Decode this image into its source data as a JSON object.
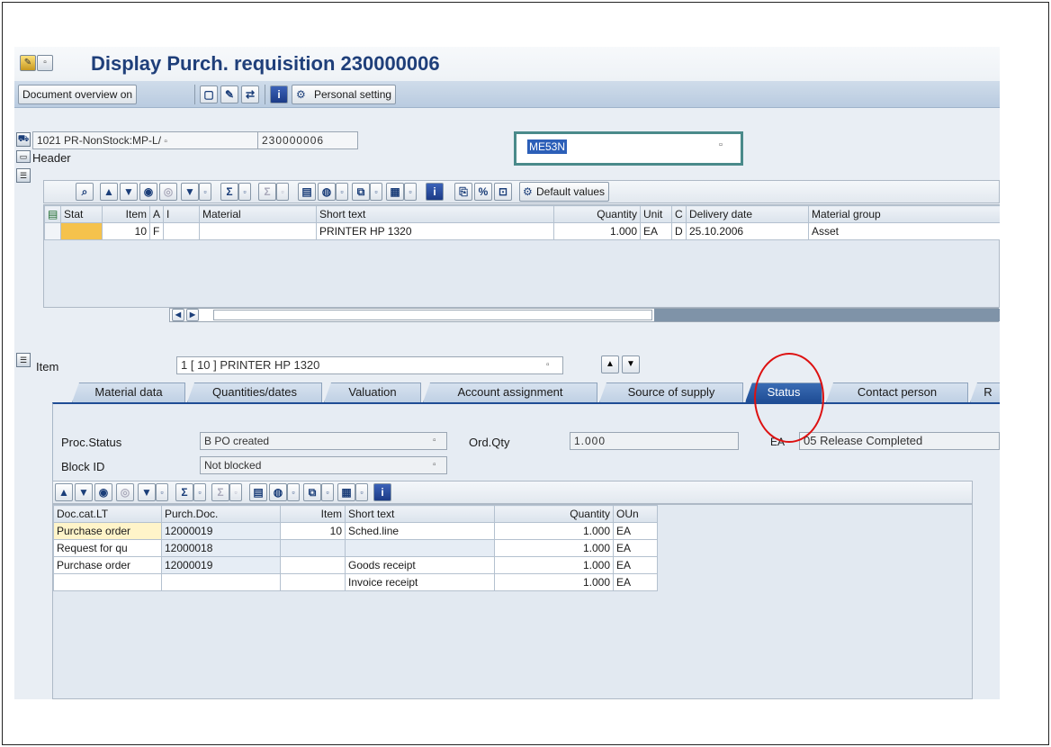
{
  "window": {
    "title": "Display Purch. requisition 230000006"
  },
  "toolbar": {
    "doc_overview_label": "Document overview on",
    "personal_setting_label": "Personal setting"
  },
  "header": {
    "doc_type": "1021 PR-NonStock:MP-L/",
    "doc_number": "230000006",
    "label": "Header"
  },
  "command_field": {
    "value": "ME53N"
  },
  "items_grid": {
    "toolbar_default_label": "Default values",
    "columns": [
      "Stat",
      "Item",
      "A",
      "I",
      "Material",
      "Short text",
      "Quantity",
      "Unit",
      "C",
      "Delivery date",
      "Material group"
    ],
    "rows": [
      {
        "stat": "",
        "item": "10",
        "a": "F",
        "i": "",
        "material": "",
        "short_text": "PRINTER HP 1320",
        "quantity": "1.000",
        "unit": "EA",
        "c": "D",
        "delivery_date": "25.10.2006",
        "material_group": "Asset"
      }
    ]
  },
  "item_section": {
    "label": "Item",
    "selected": "1 [ 10 ] PRINTER HP 1320"
  },
  "tabs": [
    {
      "label": "Material data"
    },
    {
      "label": "Quantities/dates"
    },
    {
      "label": "Valuation"
    },
    {
      "label": "Account assignment"
    },
    {
      "label": "Source of supply"
    },
    {
      "label": "Status"
    },
    {
      "label": "Contact person"
    },
    {
      "label": "R"
    }
  ],
  "status_tab": {
    "proc_status_label": "Proc.Status",
    "proc_status_value": "B PO created",
    "ord_qty_label": "Ord.Qty",
    "ord_qty_value": "1.000",
    "ord_qty_unit": "EA",
    "release_status": "05 Release Completed",
    "block_id_label": "Block ID",
    "block_id_value": "Not blocked"
  },
  "history_grid": {
    "columns": [
      "Doc.cat.LT",
      "Purch.Doc.",
      "Item",
      "Short text",
      "Quantity",
      "OUn"
    ],
    "rows": [
      {
        "doc_cat": "Purchase order",
        "purch_doc": "12000019",
        "item": "10",
        "short_text": "Sched.line",
        "quantity": "1.000",
        "oun": "EA"
      },
      {
        "doc_cat": "Request for qu",
        "purch_doc": "12000018",
        "item": "",
        "short_text": "",
        "quantity": "1.000",
        "oun": "EA"
      },
      {
        "doc_cat": "Purchase order",
        "purch_doc": "12000019",
        "item": "",
        "short_text": "Goods receipt",
        "quantity": "1.000",
        "oun": "EA"
      },
      {
        "doc_cat": "",
        "purch_doc": "",
        "item": "",
        "short_text": "Invoice receipt",
        "quantity": "1.000",
        "oun": "EA"
      }
    ]
  },
  "colors": {
    "title": "#1f3f7a",
    "active_tab": "#1f4d95",
    "highlight_circle": "#dd1111",
    "status_cell": "#f5c24c"
  }
}
